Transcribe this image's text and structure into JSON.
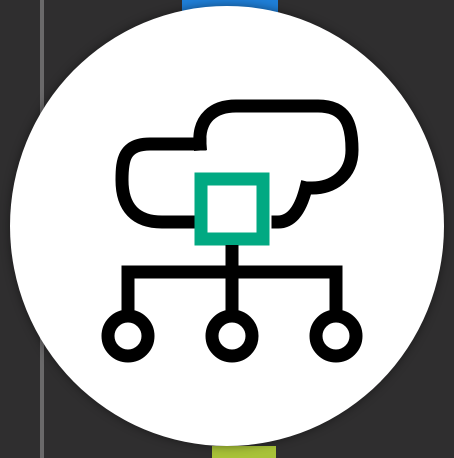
{
  "app_icon": {
    "icon_name": "cloud-network-hierarchy-icon",
    "colors": {
      "stroke": "#000000",
      "node_accent": "#01a982",
      "badge_background": "#ffffff",
      "page_background": "#2f2e2f",
      "top_accent": "#1f7fd8",
      "bottom_accent": "#a8c238"
    }
  }
}
